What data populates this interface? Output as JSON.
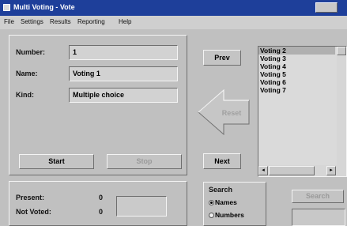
{
  "window": {
    "title": "Multi Voting - Vote",
    "close_glyph": "✕"
  },
  "menu": [
    {
      "label": "File"
    },
    {
      "label": "Settings"
    },
    {
      "label": "Results"
    },
    {
      "label": "Reporting"
    },
    {
      "label": "Help"
    }
  ],
  "details": {
    "number_label": "Number:",
    "number_value": "1",
    "name_label": "Name:",
    "name_value": "Voting 1",
    "kind_label": "Kind:",
    "kind_value": "Multiple choice"
  },
  "controls": {
    "start_label": "Start",
    "stop_label": "Stop"
  },
  "stats": {
    "present_label": "Present:",
    "present_value": "0",
    "notvoted_label": "Not Voted:",
    "notvoted_value": "0",
    "counter_value": ""
  },
  "navigation": {
    "prev_label": "Prev",
    "reset_label": "Reset",
    "next_label": "Next"
  },
  "votings_list": {
    "items": [
      "Voting 2",
      "Voting 3",
      "Voting 4",
      "Voting 5",
      "Voting 6",
      "Voting 7"
    ],
    "selected_index": 0
  },
  "search": {
    "title": "Search",
    "options": [
      {
        "label": "Names",
        "checked": true
      },
      {
        "label": "Numbers",
        "checked": false
      }
    ],
    "button_label": "Search",
    "input_value": ""
  },
  "colors": {
    "titlebar": "#1e3f9a",
    "face": "#c0c0c0"
  }
}
